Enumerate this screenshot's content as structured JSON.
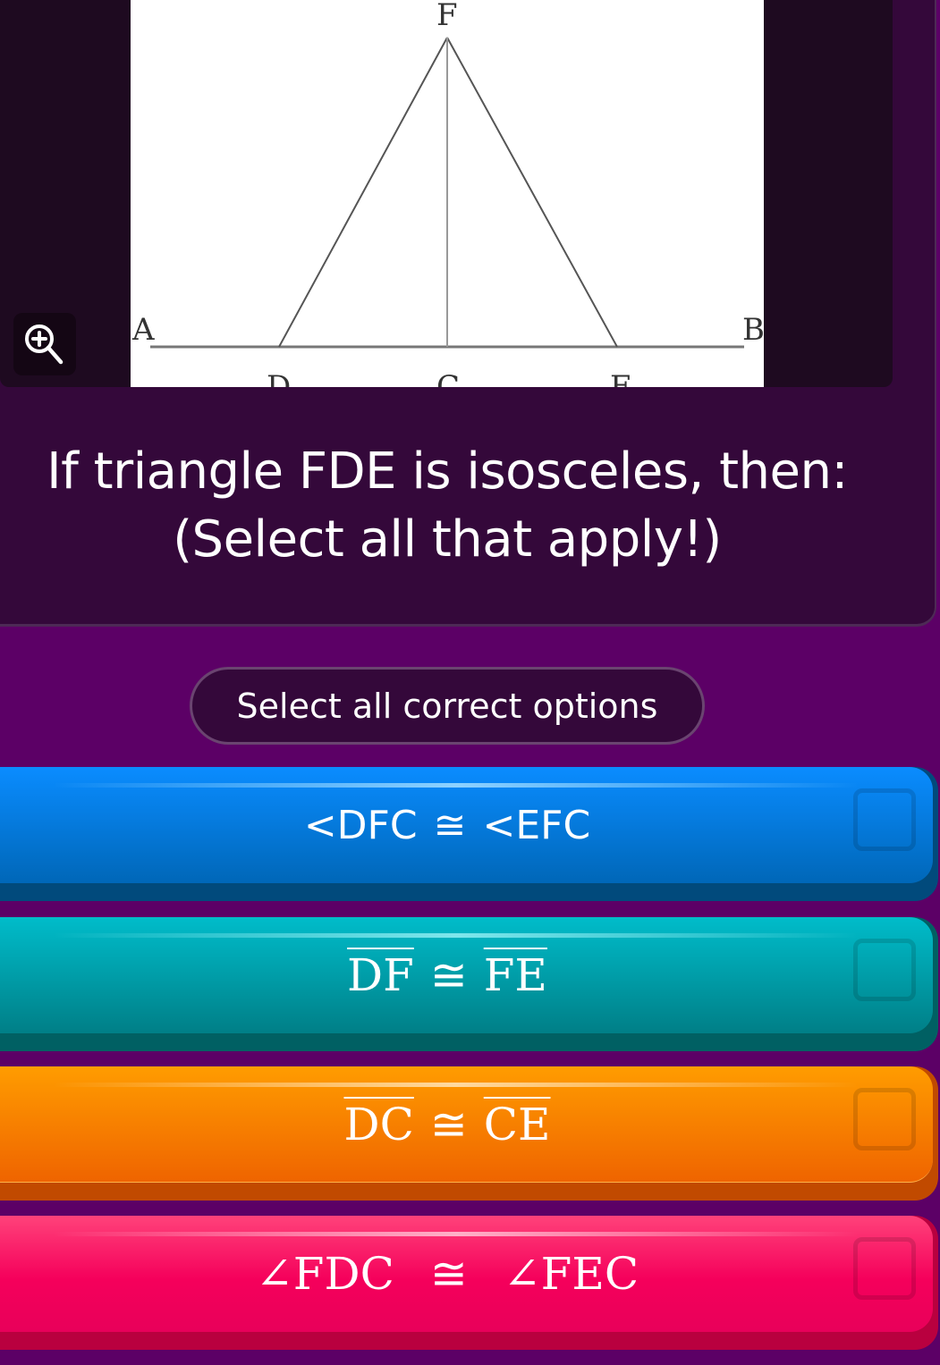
{
  "figure": {
    "description": "Triangle FDE with altitude FC on line AB",
    "points": {
      "F": "F",
      "A": "A",
      "B": "B",
      "D": "D",
      "C": "C",
      "E": "E"
    }
  },
  "zoom_button": {
    "icon": "zoom-in-icon"
  },
  "question": {
    "line1": "If triangle FDE is isosceles, then:",
    "line2": "(Select all that apply!)"
  },
  "instruction": "Select all correct options",
  "options": [
    {
      "left": "<DFC",
      "symbol": "≅",
      "right": "<EFC",
      "selected": false,
      "color": "#0a8cff"
    },
    {
      "left": "DF",
      "symbol": "≅",
      "right": "FE",
      "selected": false,
      "color": "#00bcca"
    },
    {
      "left": "DC",
      "symbol": "≅",
      "right": "CE",
      "selected": false,
      "color": "#ff9c00"
    },
    {
      "left": "∠FDC",
      "symbol": "≅",
      "right": "∠FEC",
      "selected": false,
      "color": "#ff427a"
    }
  ]
}
